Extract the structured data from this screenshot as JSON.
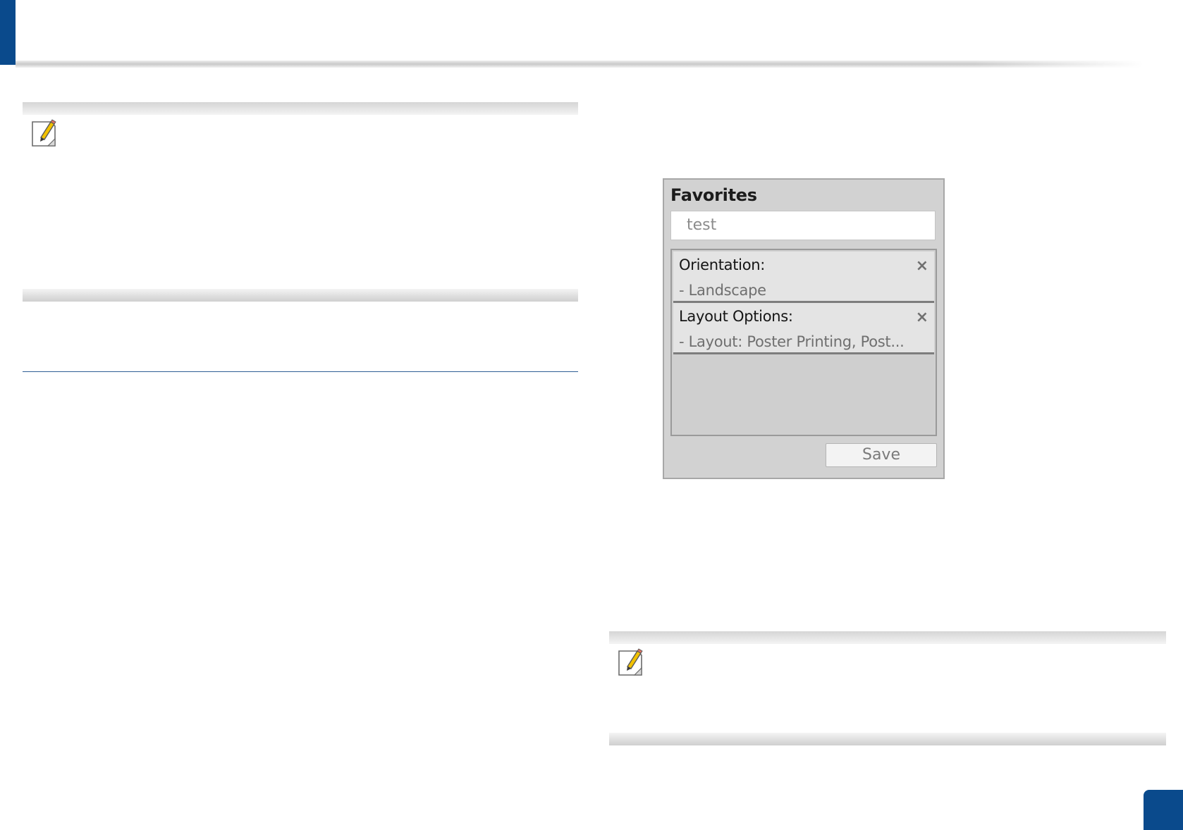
{
  "favorites": {
    "title": "Favorites",
    "name_value": "test",
    "items": [
      {
        "label": "Orientation:",
        "value": "- Landscape",
        "remove_glyph": "×"
      },
      {
        "label": "Layout Options:",
        "value": "- Layout: Poster Printing, Post...",
        "remove_glyph": "×"
      }
    ],
    "save_label": "Save"
  },
  "icons": {
    "note": "note-pencil-icon",
    "remove": "close-icon"
  },
  "colors": {
    "accent": "#0a4a8c",
    "section_rule": "#2f5f95",
    "panel_bg": "#d2d2d2"
  }
}
